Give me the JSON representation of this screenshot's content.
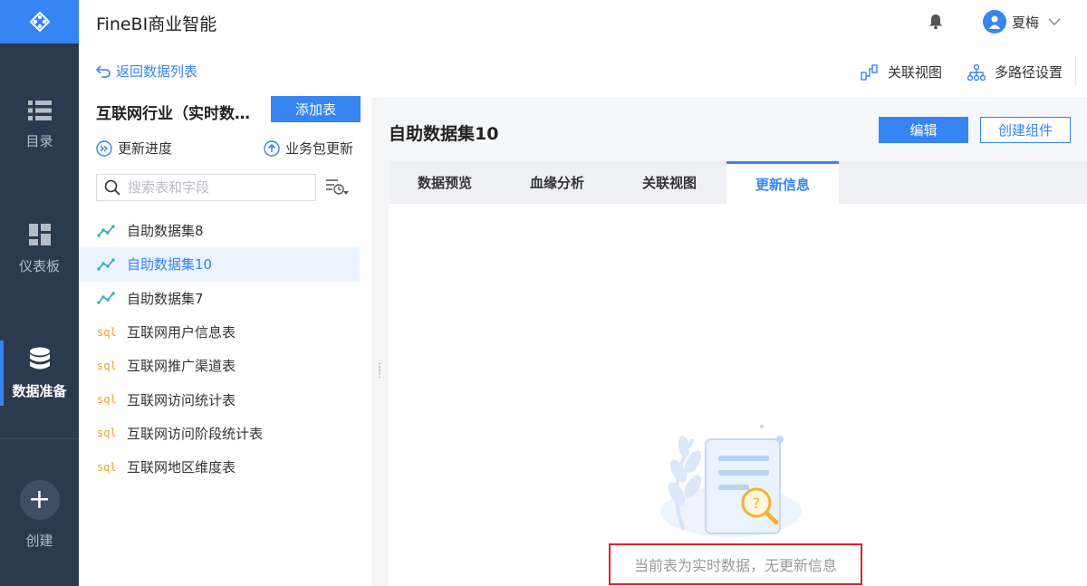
{
  "app": {
    "title": "FineBI商业智能"
  },
  "nav": {
    "items": [
      {
        "label": "目录",
        "icon": "list-icon"
      },
      {
        "label": "仪表板",
        "icon": "dashboard-icon"
      },
      {
        "label": "数据准备",
        "icon": "database-icon",
        "active": true
      }
    ],
    "create_label": "创建"
  },
  "user": {
    "name": "夏梅"
  },
  "panel": {
    "back_label": "返回数据列表",
    "package_name": "互联网行业（实时数据）",
    "add_table_label": "添加表",
    "update_progress_label": "更新进度",
    "package_update_label": "业务包更新",
    "search_placeholder": "搜索表和字段",
    "items": [
      {
        "label": "自助数据集8",
        "type": "self-service"
      },
      {
        "label": "自助数据集10",
        "type": "self-service",
        "active": true
      },
      {
        "label": "自助数据集7",
        "type": "self-service"
      },
      {
        "label": "互联网用户信息表",
        "type": "sql"
      },
      {
        "label": "互联网推广渠道表",
        "type": "sql"
      },
      {
        "label": "互联网访问统计表",
        "type": "sql"
      },
      {
        "label": "互联网访问阶段统计表",
        "type": "sql"
      },
      {
        "label": "互联网地区维度表",
        "type": "sql"
      }
    ],
    "sql_tag": "sql"
  },
  "toolbar": {
    "relation_view_label": "关联视图",
    "multipath_label": "多路径设置"
  },
  "main": {
    "dataset_title": "自助数据集10",
    "edit_label": "编辑",
    "create_component_label": "创建组件",
    "tabs": [
      {
        "label": "数据预览"
      },
      {
        "label": "血缘分析"
      },
      {
        "label": "关联视图"
      },
      {
        "label": "更新信息",
        "active": true
      }
    ],
    "empty_message": "当前表为实时数据，无更新信息"
  },
  "colors": {
    "accent": "#3685f2",
    "nav_bg": "#2c3a4f",
    "sql_tag": "#f0a020",
    "highlight_box": "#d9242b"
  }
}
